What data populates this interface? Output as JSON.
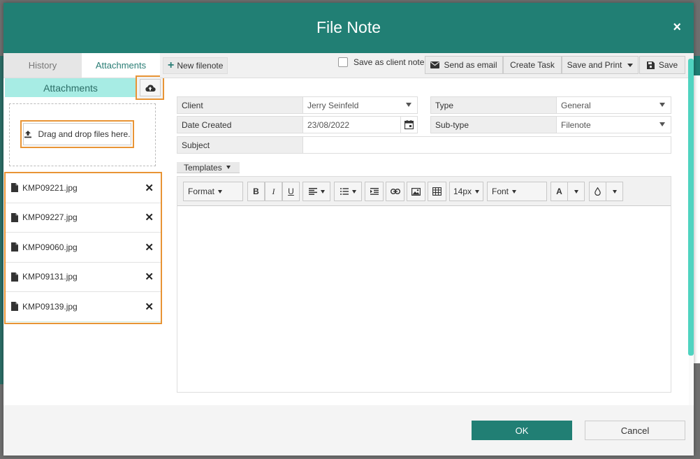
{
  "dialog": {
    "title": "File Note",
    "close_icon": "×"
  },
  "left_panel": {
    "tabs": [
      {
        "label": "History",
        "active": false
      },
      {
        "label": "Attachments",
        "active": true
      }
    ],
    "attachments_header": "Attachments",
    "upload_icon": "cloud-upload-icon",
    "drop_label": "Drag and drop files here.",
    "files": [
      {
        "name": "KMP09221.jpg"
      },
      {
        "name": "KMP09227.jpg"
      },
      {
        "name": "KMP09060.jpg"
      },
      {
        "name": "KMP09131.jpg"
      },
      {
        "name": "KMP09139.jpg"
      }
    ]
  },
  "actionbar": {
    "new_filenote": "New filenote",
    "save_as_client_note": "Save as client note",
    "send_as_email": "Send as email",
    "create_task": "Create Task",
    "save_and_print": "Save and Print",
    "save": "Save"
  },
  "form": {
    "client_label": "Client",
    "client_value": "Jerry Seinfeld",
    "type_label": "Type",
    "type_value": "General",
    "date_label": "Date Created",
    "date_value": "23/08/2022",
    "subtype_label": "Sub-type",
    "subtype_value": "Filenote",
    "subject_label": "Subject",
    "subject_value": ""
  },
  "templates_label": "Templates",
  "editor": {
    "format": "Format",
    "bold": "B",
    "italic": "I",
    "underline": "U",
    "font_size": "14px",
    "font": "Font",
    "text_color": "A"
  },
  "footer": {
    "ok": "OK",
    "cancel": "Cancel"
  },
  "colors": {
    "primary": "#217f74",
    "highlight": "#e89435",
    "attachments_header_bg": "#a7ece4"
  }
}
